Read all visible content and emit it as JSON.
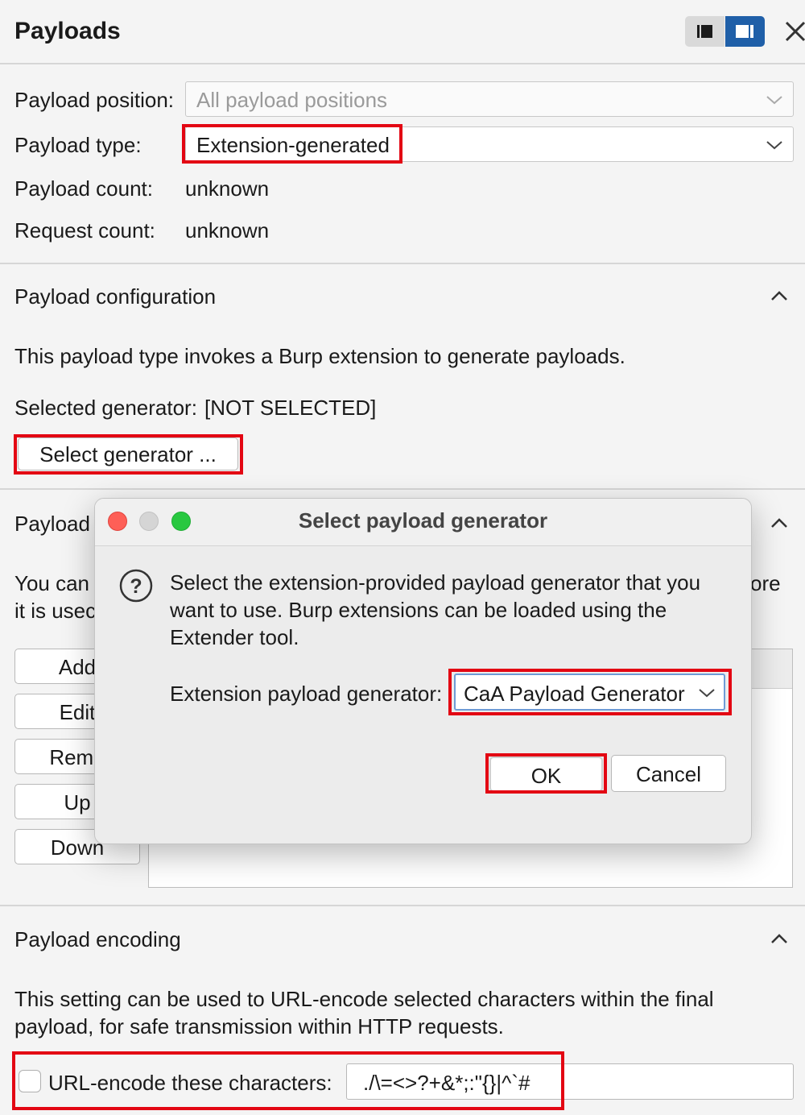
{
  "panel": {
    "title": "Payloads",
    "colors": {
      "highlight": "#e30613",
      "accent_blue": "#1f5fa8"
    }
  },
  "settings": {
    "position_label": "Payload position:",
    "position_value": "All payload positions",
    "type_label": "Payload type:",
    "type_value": "Extension-generated",
    "count_label": "Payload count:",
    "count_value": "unknown",
    "request_label": "Request count:",
    "request_value": "unknown"
  },
  "configuration": {
    "heading": "Payload configuration",
    "description": "This payload type invokes a Burp extension to generate payloads.",
    "selected_label": "Selected generator:",
    "selected_value": "[NOT SELECTED]",
    "select_button": "Select generator ..."
  },
  "processing": {
    "heading_partial": "Payload",
    "desc_line1_partial": "You can",
    "desc_line1_tail": "ore",
    "desc_line2_partial": "it is usec",
    "buttons": [
      "Add",
      "Edit",
      "Remo",
      "Up",
      "Down"
    ]
  },
  "dialog": {
    "title": "Select payload generator",
    "icon": "question-circle-icon",
    "message_line1": "Select the extension-provided payload generator that you",
    "message_line2": "want to use. Burp extensions can be loaded using the",
    "message_line3": "Extender tool.",
    "generator_label": "Extension payload generator:",
    "generator_value": "CaA Payload Generator",
    "ok_label": "OK",
    "cancel_label": "Cancel"
  },
  "encoding": {
    "heading": "Payload encoding",
    "desc_line1": "This setting can be used to URL-encode selected characters within the final",
    "desc_line2": "payload, for safe transmission within HTTP requests.",
    "checkbox_label": "URL-encode these characters:",
    "checkbox_checked": false,
    "chars_value": "./\\=<>?+&*;:\"{}|^`#"
  }
}
